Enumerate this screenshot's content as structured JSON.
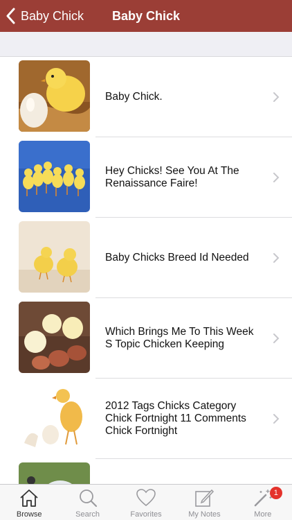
{
  "nav": {
    "back_label": "Baby Chick",
    "title": "Baby Chick"
  },
  "items": [
    {
      "title": "Baby Chick."
    },
    {
      "title": "Hey Chicks! See You At The Renaissance Faire!"
    },
    {
      "title": "Baby Chicks Breed Id Needed"
    },
    {
      "title": "Which Brings Me To This Week S Topic Chicken Keeping"
    },
    {
      "title": "2012 Tags Chicks Category Chick Fortnight 11 Comments Chick Fortnight"
    },
    {
      "title": ""
    }
  ],
  "tabs": [
    {
      "label": "Browse",
      "icon": "home-icon",
      "active": true
    },
    {
      "label": "Search",
      "icon": "search-icon"
    },
    {
      "label": "Favorites",
      "icon": "heart-icon"
    },
    {
      "label": "My Notes",
      "icon": "notes-icon"
    },
    {
      "label": "More",
      "icon": "magic-wand-icon",
      "badge": "1"
    }
  ],
  "colors": {
    "navbar": "#9b3e36",
    "badge": "#e4322b"
  }
}
